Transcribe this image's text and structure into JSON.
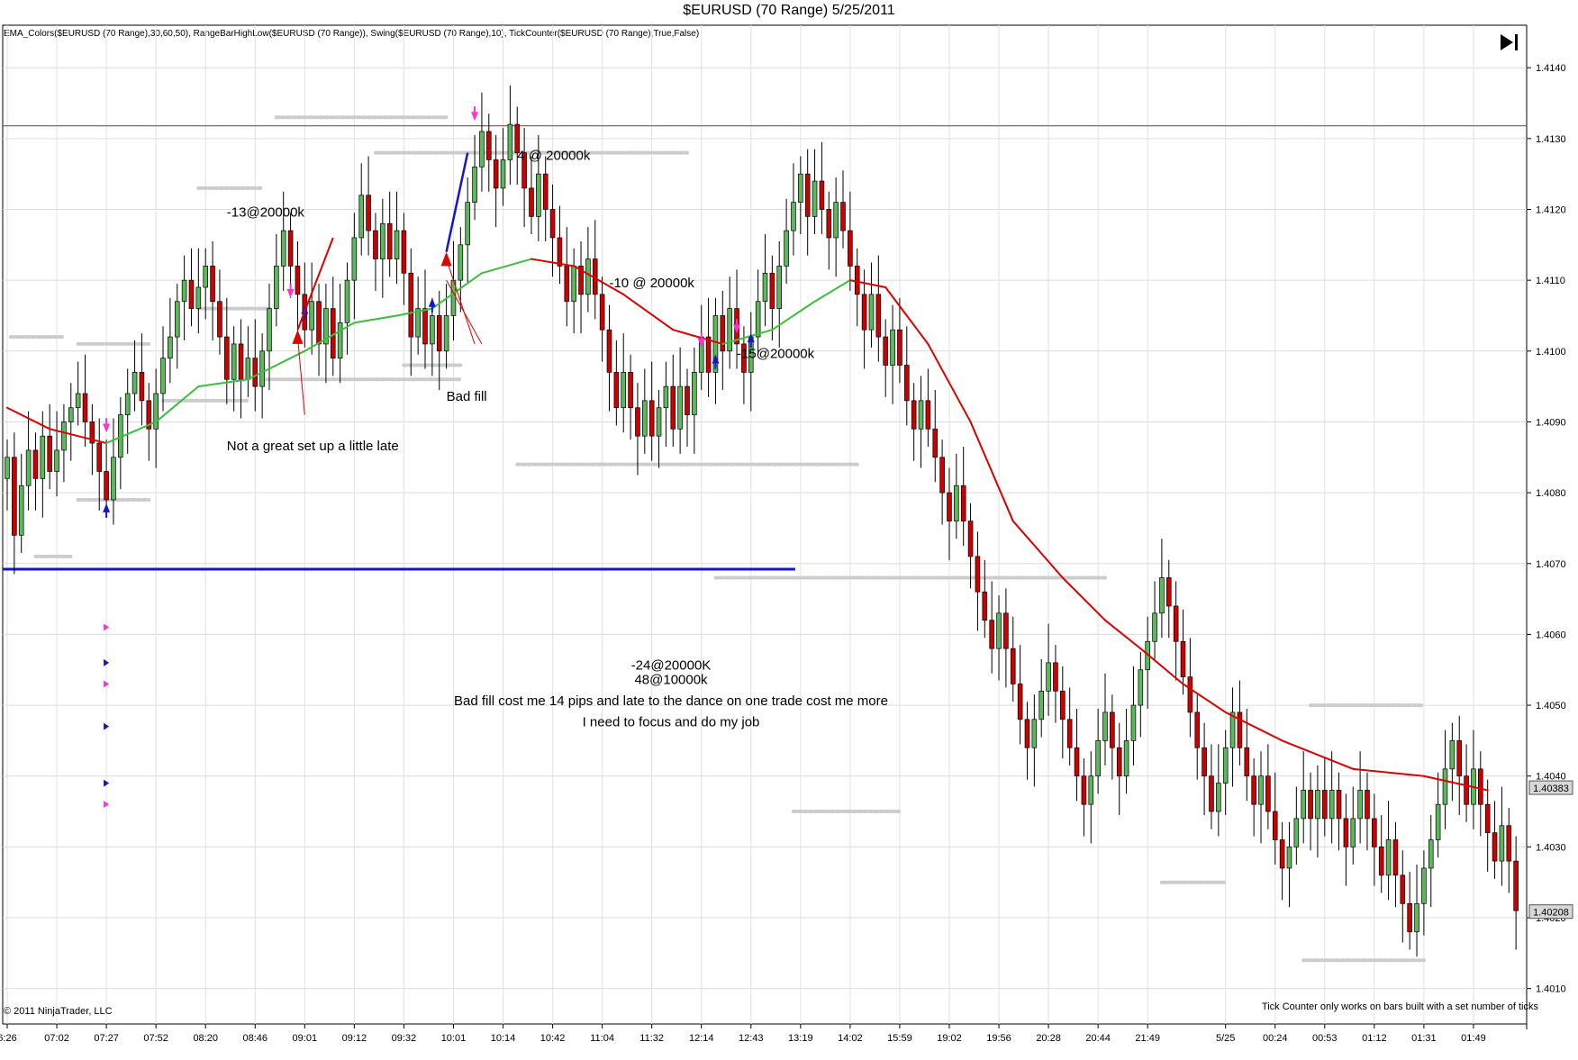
{
  "title": "$EURUSD (70 Range)  5/25/2011",
  "indicators": "EMA_Colors($EURUSD (70 Range),30,60,50), RangeBarHighLow($EURUSD (70 Range)), Swing($EURUSD (70 Range),10), TickCounter($EURUSD (70 Range),True,False)",
  "copyright": "© 2011 NinjaTrader, LLC",
  "tick_note": "Tick Counter only works on bars built with a set number of ticks",
  "icons": {
    "end": "skip-to-end-icon"
  },
  "colors": {
    "bull": "#5cb85c",
    "bear": "#cc0000",
    "ema_up": "#3cbf3c",
    "ema_down": "#dd0000",
    "blue": "#1515cc",
    "magenta": "#ff33cc",
    "hline_top": "#a04050",
    "swing": "#cccccc"
  },
  "chart_data": {
    "type": "candlestick",
    "title": "$EURUSD (70 Range)  5/25/2011",
    "ylim": [
      1.401,
      1.414
    ],
    "y_ticks": [
      "1.4140",
      "1.4130",
      "1.4120",
      "1.4110",
      "1.4100",
      "1.4090",
      "1.4080",
      "1.4070",
      "1.4060",
      "1.4050",
      "1.4040",
      "1.4030",
      "1.4020",
      "1.4010"
    ],
    "x_ticks": [
      {
        "label": "6:26",
        "i": 0
      },
      {
        "label": "07:02",
        "i": 7
      },
      {
        "label": "07:27",
        "i": 14
      },
      {
        "label": "07:52",
        "i": 21
      },
      {
        "label": "08:20",
        "i": 28
      },
      {
        "label": "08:46",
        "i": 35
      },
      {
        "label": "09:01",
        "i": 42
      },
      {
        "label": "09:12",
        "i": 49
      },
      {
        "label": "09:32",
        "i": 56
      },
      {
        "label": "10:01",
        "i": 63
      },
      {
        "label": "10:14",
        "i": 70
      },
      {
        "label": "10:42",
        "i": 77
      },
      {
        "label": "11:04",
        "i": 84
      },
      {
        "label": "11:32",
        "i": 91
      },
      {
        "label": "12:14",
        "i": 98
      },
      {
        "label": "12:43",
        "i": 105
      },
      {
        "label": "13:19",
        "i": 112
      },
      {
        "label": "14:02",
        "i": 119
      },
      {
        "label": "15:59",
        "i": 126
      },
      {
        "label": "19:02",
        "i": 133
      },
      {
        "label": "19:56",
        "i": 140
      },
      {
        "label": "20:28",
        "i": 147
      },
      {
        "label": "20:44",
        "i": 154
      },
      {
        "label": "21:49",
        "i": 161
      },
      {
        "label": "5/25",
        "i": 172
      },
      {
        "label": "00:24",
        "i": 179
      },
      {
        "label": "00:53",
        "i": 186
      },
      {
        "label": "01:12",
        "i": 193
      },
      {
        "label": "01:31",
        "i": 200
      },
      {
        "label": "01:49",
        "i": 207
      }
    ],
    "close": [
      1.4085,
      1.4074,
      1.4081,
      1.4086,
      1.4082,
      1.4088,
      1.4083,
      1.4086,
      1.409,
      1.4092,
      1.4094,
      1.409,
      1.4087,
      1.4083,
      1.4079,
      1.4085,
      1.4091,
      1.4094,
      1.4097,
      1.4093,
      1.4089,
      1.4094,
      1.4099,
      1.4102,
      1.4107,
      1.411,
      1.4106,
      1.4109,
      1.4112,
      1.4107,
      1.4102,
      1.4096,
      1.4101,
      1.4096,
      1.4099,
      1.4095,
      1.41,
      1.4106,
      1.4112,
      1.4117,
      1.4112,
      1.4108,
      1.4103,
      1.4107,
      1.4101,
      1.4106,
      1.4099,
      1.4104,
      1.411,
      1.4116,
      1.4122,
      1.4117,
      1.4113,
      1.4118,
      1.4113,
      1.4117,
      1.4111,
      1.4102,
      1.4106,
      1.4101,
      1.4105,
      1.41,
      1.4105,
      1.411,
      1.4115,
      1.4121,
      1.4126,
      1.4131,
      1.4127,
      1.4123,
      1.4127,
      1.4132,
      1.4128,
      1.4123,
      1.4119,
      1.4125,
      1.412,
      1.4116,
      1.4112,
      1.4107,
      1.4112,
      1.4108,
      1.4113,
      1.4108,
      1.4103,
      1.4097,
      1.4092,
      1.4097,
      1.4092,
      1.4088,
      1.4093,
      1.4088,
      1.4092,
      1.4095,
      1.4089,
      1.4095,
      1.4091,
      1.4097,
      1.4102,
      1.4097,
      1.4105,
      1.41,
      1.4106,
      1.4101,
      1.4097,
      1.4102,
      1.4107,
      1.4111,
      1.4106,
      1.4112,
      1.4117,
      1.4121,
      1.4125,
      1.4119,
      1.4124,
      1.412,
      1.4116,
      1.4121,
      1.4117,
      1.4112,
      1.4108,
      1.4103,
      1.4108,
      1.4102,
      1.4098,
      1.4103,
      1.4098,
      1.4093,
      1.4089,
      1.4093,
      1.4089,
      1.4085,
      1.408,
      1.4076,
      1.4081,
      1.4076,
      1.4071,
      1.4066,
      1.4062,
      1.4058,
      1.4063,
      1.4058,
      1.4053,
      1.4048,
      1.4044,
      1.4048,
      1.4052,
      1.4056,
      1.4052,
      1.4048,
      1.4044,
      1.404,
      1.4036,
      1.404,
      1.4045,
      1.4049,
      1.4044,
      1.404,
      1.4045,
      1.405,
      1.4055,
      1.4059,
      1.4063,
      1.4068,
      1.4064,
      1.4059,
      1.4054,
      1.4049,
      1.4044,
      1.404,
      1.4035,
      1.4039,
      1.4044,
      1.4049,
      1.4044,
      1.404,
      1.4036,
      1.404,
      1.4035,
      1.4031,
      1.4027,
      1.403,
      1.4034,
      1.4038,
      1.4034,
      1.4038,
      1.4034,
      1.4038,
      1.4034,
      1.403,
      1.4034,
      1.4038,
      1.4034,
      1.403,
      1.4026,
      1.4031,
      1.4026,
      1.4022,
      1.4018,
      1.4022,
      1.4027,
      1.4031,
      1.4036,
      1.4041,
      1.4045,
      1.404,
      1.4036,
      1.4041,
      1.4036,
      1.4032,
      1.4028,
      1.4033,
      1.4028,
      1.4021
    ],
    "ema": [
      [
        1.4092,
        0
      ],
      [
        1.4089,
        6
      ],
      [
        1.4087,
        14
      ],
      [
        1.409,
        21
      ],
      [
        1.4095,
        27
      ],
      [
        1.4096,
        34
      ],
      [
        1.41,
        42
      ],
      [
        1.4104,
        49
      ],
      [
        1.4105,
        55
      ],
      [
        1.4106,
        60
      ],
      [
        1.4111,
        67
      ],
      [
        1.4113,
        74
      ],
      [
        1.4112,
        80
      ],
      [
        1.4108,
        87
      ],
      [
        1.4103,
        94
      ],
      [
        1.4101,
        101
      ],
      [
        1.4103,
        108
      ],
      [
        1.4107,
        114
      ],
      [
        1.411,
        119
      ],
      [
        1.4109,
        124
      ],
      [
        1.4101,
        130
      ],
      [
        1.409,
        136
      ],
      [
        1.4076,
        142
      ],
      [
        1.4068,
        149
      ],
      [
        1.4062,
        155
      ],
      [
        1.4058,
        160
      ],
      [
        1.4053,
        166
      ],
      [
        1.4049,
        172
      ],
      [
        1.4045,
        180
      ],
      [
        1.4041,
        190
      ],
      [
        1.404,
        200
      ],
      [
        1.4038,
        209
      ]
    ],
    "series": [
      {
        "name": "EMA_Colors"
      },
      {
        "name": "RangeBarHighLow"
      },
      {
        "name": "Swing"
      }
    ],
    "price_labels": [
      "1.40383",
      "1.40208"
    ],
    "horizontal_lines": [
      {
        "y": 1.41318,
        "color": "hline_top"
      },
      {
        "y": 1.40692,
        "color": "blue",
        "x_end_frac": 0.52
      }
    ],
    "annotations": [
      "-13@20000k",
      "Not a great set up a little late",
      "Bad fill",
      "4 @ 20000k",
      "-10 @ 20000k",
      "-15@20000k",
      "-24@20000K",
      "48@10000k",
      "Bad fill cost me 14 pips and late to the dance on one trade cost me more",
      "I need to focus and do my job"
    ]
  }
}
